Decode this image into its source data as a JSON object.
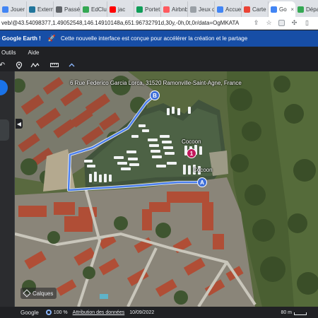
{
  "browser": {
    "tabs": [
      {
        "label": "Jouer",
        "icon": "google-icon",
        "color": "#4285f4"
      },
      {
        "label": "Extern",
        "icon": "wordpress-icon",
        "color": "#21759b"
      },
      {
        "label": "Passé",
        "icon": "page-icon",
        "color": "#5f6368"
      },
      {
        "label": "EdClub",
        "icon": "edclub-icon",
        "color": "#34a853"
      },
      {
        "label": "jac",
        "icon": "youtube-icon",
        "color": "#ff0000"
      },
      {
        "label": "Portet",
        "icon": "calameo-icon",
        "color": "#0f9d58"
      },
      {
        "label": "Airbnb",
        "icon": "airbnb-icon",
        "color": "#ff5a5f"
      },
      {
        "label": "Jeux d",
        "icon": "page-icon",
        "color": "#9aa0a6"
      },
      {
        "label": "Accue",
        "icon": "page-icon",
        "color": "#4285f4"
      },
      {
        "label": "Carte",
        "icon": "page-icon",
        "color": "#ea4335"
      },
      {
        "label": "Go",
        "icon": "google-earth-icon",
        "color": "#4285f4",
        "active": true
      },
      {
        "label": "Dépar",
        "icon": "page-icon",
        "color": "#34a853"
      }
    ],
    "url": "veb/@43.54098377,1.49052548,146.14910148a,651.96732791d,30y,-0h,0t,0r/data=OgMKATA"
  },
  "banner": {
    "title": "e Google Earth !",
    "message": "Cette nouvelle interface est conçue pour accélérer la création et le partage"
  },
  "menu": {
    "items": [
      "Outils",
      "Aide"
    ]
  },
  "map": {
    "address": "6 Rue Federico Garcia Lorca, 31520 Ramonville-Saint-Agne, France",
    "poi_label": "Cocoon",
    "poi_label_2": "Cocoon",
    "marker_pink": "1",
    "marker_b": "B",
    "marker_a": "A",
    "layers_label": "Calques",
    "route_color": "#4a7ff0",
    "marker_color": "#3f6fd9",
    "poi_color": "#c2185b"
  },
  "status": {
    "brand": "Google",
    "percent": "100 %",
    "attribution": "Attribution des données",
    "date": "10/09/2022",
    "scale": "80 m"
  }
}
